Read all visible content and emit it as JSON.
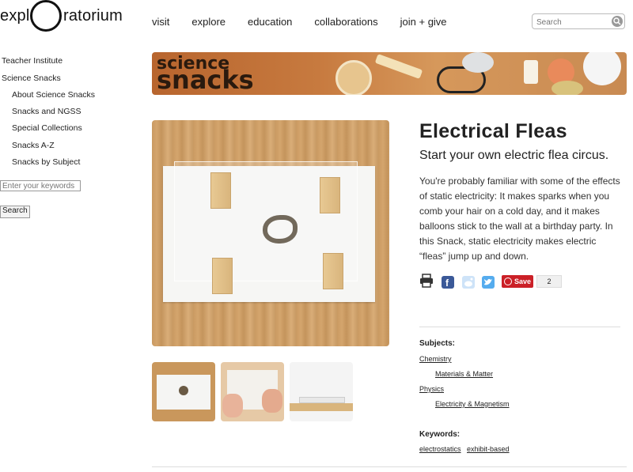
{
  "header": {
    "logo_left": "expl",
    "logo_right": "ratorium",
    "nav": [
      "visit",
      "explore",
      "education",
      "collaborations",
      "join + give"
    ],
    "search_placeholder": "Search"
  },
  "sidebar": {
    "items": [
      "Teacher Institute",
      "Science Snacks",
      "About Science Snacks",
      "Snacks and NGSS",
      "Special Collections",
      "Snacks A-Z",
      "Snacks by Subject"
    ],
    "keyword_placeholder": "Enter your keywords",
    "search_button": "Search"
  },
  "banner": {
    "line1": "science",
    "line2": "snacks"
  },
  "article": {
    "title": "Electrical Fleas",
    "subtitle": "Start your own electric flea circus.",
    "description": "You're probably familiar with some of the effects of static electricity: It makes sparks when you comb your hair on a cold day, and it makes balloons stick to the wall at a birthday party. In this Snack, static electricity makes electric “fleas” jump up and down.",
    "pin_label": "Save",
    "pin_count": "2"
  },
  "meta": {
    "subjects_label": "Subjects:",
    "subjects": [
      {
        "name": "Chemistry",
        "sub": "Materials & Matter"
      },
      {
        "name": "Physics",
        "sub": "Electricity & Magnetism"
      }
    ],
    "keywords_label": "Keywords:",
    "keywords": [
      "electrostatics",
      "exhibit-based"
    ]
  },
  "icons": [
    "print-icon",
    "facebook-icon",
    "reddit-icon",
    "twitter-icon",
    "pinterest-icon"
  ],
  "colors": {
    "facebook": "#3b5998",
    "reddit": "#cee3f8",
    "twitter": "#55acee",
    "pinterest": "#cb2027"
  }
}
